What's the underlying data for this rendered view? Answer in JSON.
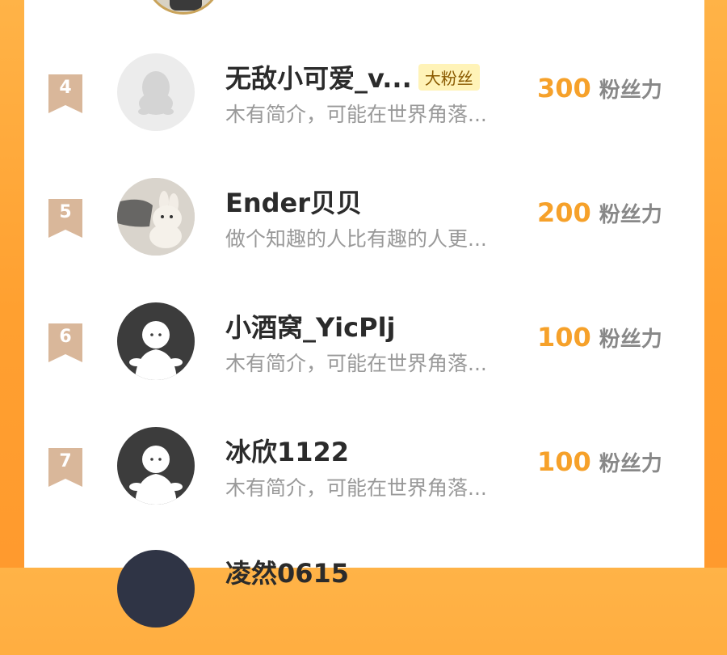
{
  "colors": {
    "background": "#ffa030",
    "score": "#f6a12a",
    "badge": "#d9b79a",
    "fan_tag_bg": "#fff3b8"
  },
  "rows": [
    {
      "rank": "4",
      "name": "无敌小可爱_v...",
      "tag": "大粉丝",
      "bio": "木有简介，可能在世界角落...",
      "score": "300",
      "unit": "粉丝力",
      "avatar_icon": "qq-penguin-placeholder-icon"
    },
    {
      "rank": "5",
      "name": "Ender贝贝",
      "bio": "做个知趣的人比有趣的人更...",
      "score": "200",
      "unit": "粉丝力",
      "avatar_icon": "plush-bunny-photo"
    },
    {
      "rank": "6",
      "name": "小酒窝_YicPlj",
      "bio": "木有简介，可能在世界角落...",
      "score": "100",
      "unit": "粉丝力",
      "avatar_icon": "default-ghost-avatar-icon"
    },
    {
      "rank": "7",
      "name": "冰欣1122",
      "bio": "木有简介，可能在世界角落...",
      "score": "100",
      "unit": "粉丝力",
      "avatar_icon": "default-ghost-avatar-icon"
    },
    {
      "name": "凌然0615"
    }
  ]
}
